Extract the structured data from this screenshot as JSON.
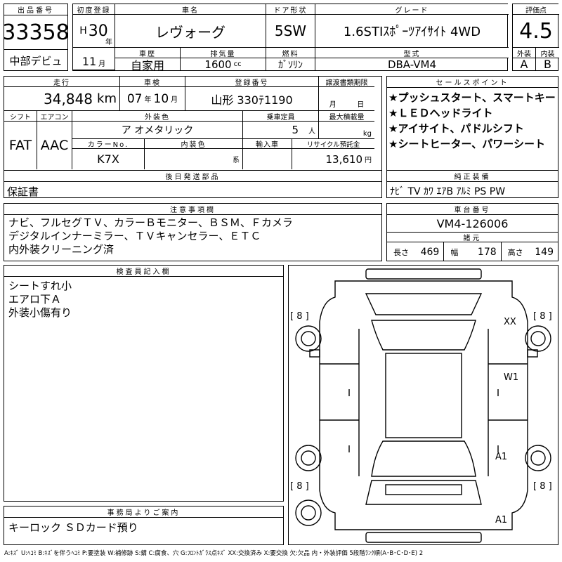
{
  "listing": {
    "no_label": "出品番号",
    "no": "33358",
    "debut": "中部デビュ",
    "first_reg_label": "初度登録",
    "era": "H",
    "year": "30",
    "year_unit": "年",
    "month": "11",
    "month_unit": "月",
    "name_label": "車名",
    "name": "レヴォーグ",
    "door_label": "ドア形状",
    "door": "5SW",
    "grade_label": "グレード",
    "grade": "1.6STIｽﾎﾟｰﾂｱｲｻｲﾄ 4WD",
    "score_label": "評価点",
    "score": "4.5",
    "ext_label": "外装",
    "int_label": "内装",
    "ext_grade": "A",
    "int_grade": "B",
    "history_label": "車歴",
    "history": "自家用",
    "disp_label": "排気量",
    "disp": "1600",
    "disp_unit": "cc",
    "fuel_label": "燃料",
    "fuel": "ｶﾞｿﾘﾝ",
    "model_label": "型式",
    "model": "DBA-VM4"
  },
  "details": {
    "mileage_label": "走行",
    "mileage": "34,848",
    "mileage_unit": "km",
    "inspection_label": "車検",
    "insp_year": "07",
    "insp_year_unit": "年",
    "insp_month": "10",
    "insp_month_unit": "月",
    "reg_label": "登録番号",
    "reg": "山形 330ﾃ1190",
    "transfer_label": "譲渡書類期限",
    "transfer_month_unit": "月",
    "transfer_day_unit": "日",
    "shift_label": "シフト",
    "shift": "FAT",
    "ac_label": "エアコン",
    "ac": "AAC",
    "color_label": "外装色",
    "color": "ア オメタリック",
    "capacity_label": "乗車定員",
    "capacity": "5",
    "capacity_unit": "人",
    "load_label": "最大積載量",
    "load_unit": "kg",
    "color_no_label": "カラーNo.",
    "color_no": "K7X",
    "interior_label": "内装色",
    "interior_unit": "系",
    "import_label": "輸入車",
    "recycle_label": "リサイクル預託金",
    "recycle": "13,610",
    "recycle_unit": "円"
  },
  "sales_points": {
    "label": "セールスポイント",
    "items": [
      "★プッシュスタート、スマートキー",
      "★ＬＥＤヘッドライト",
      "★アイサイト、パドルシフト",
      "★シートヒーター、パワーシート"
    ]
  },
  "later_parts": {
    "label": "後日発送部品",
    "value": "保証書"
  },
  "equipment": {
    "label": "純正装備",
    "value": "ﾅﾋﾞ TV ｶﾜ ｴｱB ｱﾙﾐ PS PW"
  },
  "notes": {
    "label": "注意事項欄",
    "lines": [
      "ナビ、フルセグＴＶ、カラーＢモニター、ＢＳＭ、Ｆカメラ",
      "デジタルインナーミラー、ＴＶキャンセラー、ＥＴＣ",
      "内外装クリーニング済"
    ]
  },
  "chassis": {
    "label": "車台番号",
    "value": "VM4-126006"
  },
  "dims": {
    "label": "諸元",
    "length_label": "長さ",
    "length": "469",
    "width_label": "幅",
    "width": "178",
    "height_label": "高さ",
    "height": "149"
  },
  "inspector": {
    "label": "検査員記入欄",
    "lines": [
      "シートすれ小",
      "エアロ下Ａ",
      "外装小傷有り"
    ]
  },
  "office": {
    "label": "事務局よりご案内",
    "value": "キーロック ＳＤカード預り"
  },
  "diagram": {
    "tire_tl": "[ 8 ]",
    "tire_tr": "[ 8 ]",
    "tire_bl": "[ 8 ]",
    "tire_br": "[ 8 ]",
    "mark_xx": "XX",
    "mark_w1": "W1",
    "mark_a1_mid": "A1",
    "mark_a1_bottom": "A1"
  },
  "legend": "A:ｷｽﾞ U:ﾍｺﾐ B:ｷｽﾞを伴うﾍｺﾐ P:要塗装 W:補修跡 S:錆 C:腐食、穴 G:ﾌﾛﾝﾄｶﾞﾗｽ点ｷｽﾞ XX:交換済み X:要交換 欠:欠品 内・外装評価 5段階ﾗﾝｸ順(A･B･C･D･E) 2"
}
